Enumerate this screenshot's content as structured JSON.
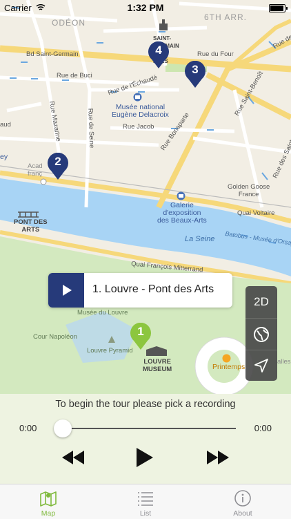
{
  "status_bar": {
    "carrier": "Carrier",
    "time": "1:32 PM"
  },
  "map": {
    "labels": {
      "odeon": "ODÉON",
      "sixth_arr": "6TH ARR.",
      "saint_germain": "SAINT-\nGERMAIN\nDES-\nPRÈS",
      "rue_du_four": "Rue du Four",
      "bd_saint_germain": "Bd Saint-Germain",
      "rue_de_buci": "Rue de Buci",
      "rue_de_lechaude": "Rue de l'Échaudé",
      "rue_de_rennes": "Rue de",
      "musee_delacroix": "Musée national\nEugène Delacroix",
      "rue_mazarine": "Rue Mazarine",
      "rue_de_seine": "Rue de Seine",
      "rue_jacob": "Rue Jacob",
      "rue_bonaparte": "Rue Bonaparte",
      "rue_saint_benoit": "Rue Saint-Benoît",
      "rue_st_peres": "Rue des Saints-Pères",
      "academie": "Acad\nfranç",
      "ey": "ey",
      "aud": "aud",
      "golden_goose": "Golden Goose\nFrance",
      "quai_voltaire": "Quai Voltaire",
      "galerie": "Galerie\nd'exposition\ndes Beaux-Arts",
      "pont_des_arts": "PONT DES\nARTS",
      "la_seine": "La Seine",
      "batobus": "Batobus - Musée d'Orsay",
      "quai_francois": "Quai François Mitterrand",
      "musee_du_louvre": "Musée du Louvre",
      "cour_napoleon": "Cour Napoléon",
      "louvre_pyramid": "Louvre Pyramid",
      "louvre_museum": "LOUVRE\nMUSEUM",
      "printemps": "Printemps",
      "salles": "alles"
    },
    "pins": [
      {
        "number": "4",
        "color": "#263a7a"
      },
      {
        "number": "3",
        "color": "#263a7a"
      },
      {
        "number": "2",
        "color": "#263a7a"
      },
      {
        "number": "1",
        "color": "#8cc63f"
      }
    ],
    "callout": {
      "title": "1. Louvre - Pont des Arts"
    },
    "controls": {
      "mode_label": "2D",
      "globe_icon": "globe-icon",
      "location_icon": "location-arrow-icon"
    }
  },
  "player": {
    "hint": "To begin the tour please pick a recording",
    "elapsed": "0:00",
    "remaining": "0:00",
    "progress": 0
  },
  "tabs": [
    {
      "label": "Map",
      "icon": "map-icon",
      "active": true,
      "color": "#7fb93c"
    },
    {
      "label": "List",
      "icon": "list-icon",
      "active": false
    },
    {
      "label": "About",
      "icon": "info-icon",
      "active": false
    }
  ]
}
